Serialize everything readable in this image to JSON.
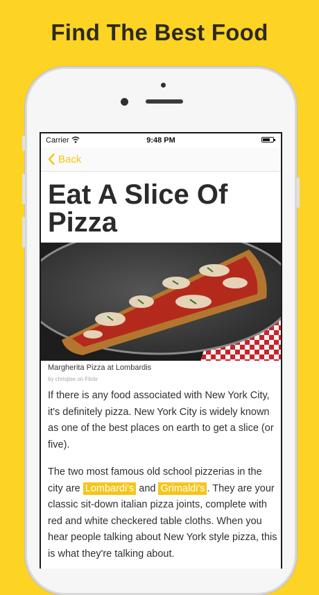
{
  "promo": {
    "title": "Find The Best Food"
  },
  "status_bar": {
    "carrier": "Carrier",
    "time": "9:48 PM"
  },
  "nav": {
    "back_label": "Back"
  },
  "article": {
    "title": "Eat A Slice Of Pizza",
    "image": {
      "caption": "Margherita Pizza at Lombardis",
      "credit": "by chrisjtse on Flickr"
    },
    "paragraph1": "If there is any food associated with New York City, it's definitely pizza. New York City is widely known as one of the best places on earth to get a slice (or five).",
    "paragraph2": {
      "before": "The two most famous old school pizzerias in the city are ",
      "link1": "Lombardi's",
      "between": " and ",
      "link2": "Grimaldi's",
      "after": ". They are your classic sit-down italian pizza joints, complete with red and white checkered table cloths. When you hear people talking about New York style pizza, this is what they're talking about."
    }
  },
  "colors": {
    "background": "#FDD324",
    "accent": "#F5C518",
    "text": "#2b2b2b"
  },
  "icons": [
    "wifi-icon",
    "battery-icon",
    "chevron-left-icon"
  ]
}
